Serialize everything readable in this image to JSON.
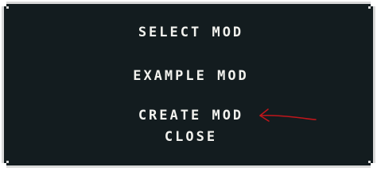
{
  "menu": {
    "title": "SELECT MOD",
    "items": [
      {
        "label": "EXAMPLE MOD"
      },
      {
        "label": "CREATE MOD"
      },
      {
        "label": "CLOSE"
      }
    ]
  },
  "annotation": {
    "arrow_color": "#c0161b",
    "icon": "hand-drawn-arrow-left-icon"
  },
  "colors": {
    "panel_background": "#131c1f",
    "panel_border": "#d9d9d9",
    "text": "#f2f2ee"
  }
}
